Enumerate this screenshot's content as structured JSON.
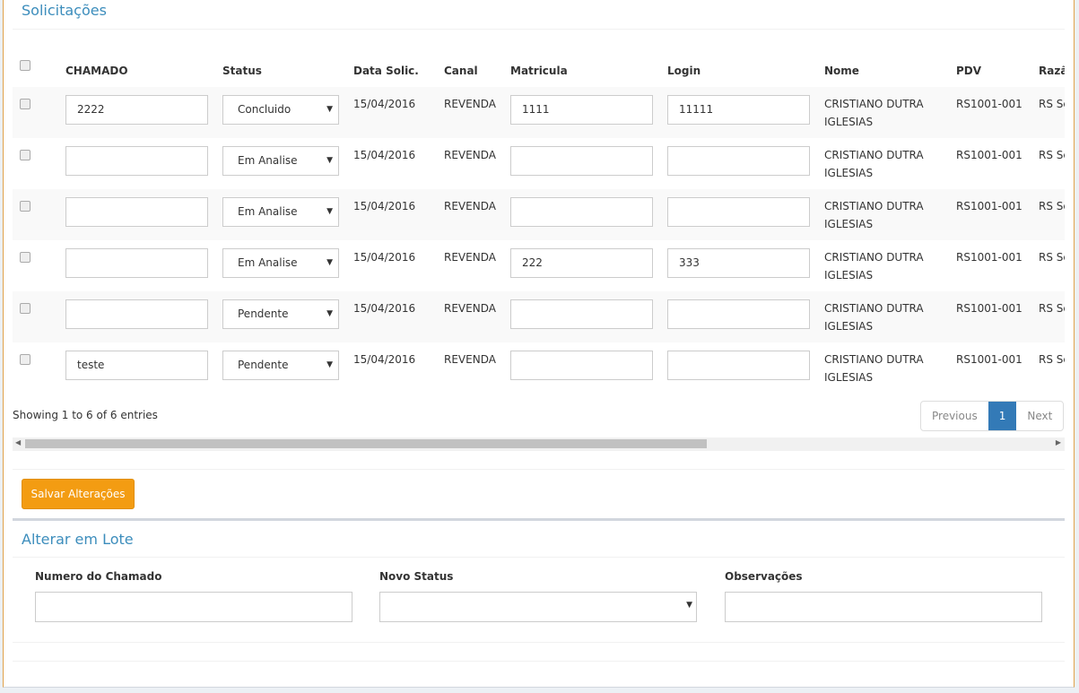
{
  "section_title": "Solicitações",
  "columns": [
    "CHAMADO",
    "Status",
    "Data Solic.",
    "Canal",
    "Matricula",
    "Login",
    "Nome",
    "PDV",
    "Razã"
  ],
  "rows": [
    {
      "chamado": "2222",
      "status": "Concluido",
      "data": "15/04/2016",
      "canal": "REVENDA",
      "matricula": "1111",
      "login": "11111",
      "nome": "CRISTIANO DUTRA IGLESIAS",
      "pdv": "RS1001-001",
      "razao": "RS Se"
    },
    {
      "chamado": "",
      "status": "Em Analise",
      "data": "15/04/2016",
      "canal": "REVENDA",
      "matricula": "",
      "login": "",
      "nome": "CRISTIANO DUTRA IGLESIAS",
      "pdv": "RS1001-001",
      "razao": "RS Se"
    },
    {
      "chamado": "",
      "status": "Em Analise",
      "data": "15/04/2016",
      "canal": "REVENDA",
      "matricula": "",
      "login": "",
      "nome": "CRISTIANO DUTRA IGLESIAS",
      "pdv": "RS1001-001",
      "razao": "RS Se"
    },
    {
      "chamado": "",
      "status": "Em Analise",
      "data": "15/04/2016",
      "canal": "REVENDA",
      "matricula": "222",
      "login": "333",
      "nome": "CRISTIANO DUTRA IGLESIAS",
      "pdv": "RS1001-001",
      "razao": "RS Se"
    },
    {
      "chamado": "",
      "status": "Pendente",
      "data": "15/04/2016",
      "canal": "REVENDA",
      "matricula": "",
      "login": "",
      "nome": "CRISTIANO DUTRA IGLESIAS",
      "pdv": "RS1001-001",
      "razao": "RS Se"
    },
    {
      "chamado": "teste",
      "status": "Pendente",
      "data": "15/04/2016",
      "canal": "REVENDA",
      "matricula": "",
      "login": "",
      "nome": "CRISTIANO DUTRA IGLESIAS",
      "pdv": "RS1001-001",
      "razao": "RS Se"
    }
  ],
  "table_info": "Showing 1 to 6 of 6 entries",
  "pagination": {
    "previous": "Previous",
    "current": "1",
    "next": "Next"
  },
  "save_button": "Salvar Alterações",
  "batch": {
    "title": "Alterar em Lote",
    "numero_label": "Numero do Chamado",
    "numero_value": "",
    "status_label": "Novo Status",
    "status_value": "",
    "obs_label": "Observações",
    "obs_value": ""
  },
  "colors": {
    "accent": "#3c8dbc",
    "button": "#f39c12",
    "page_active": "#337ab7"
  }
}
